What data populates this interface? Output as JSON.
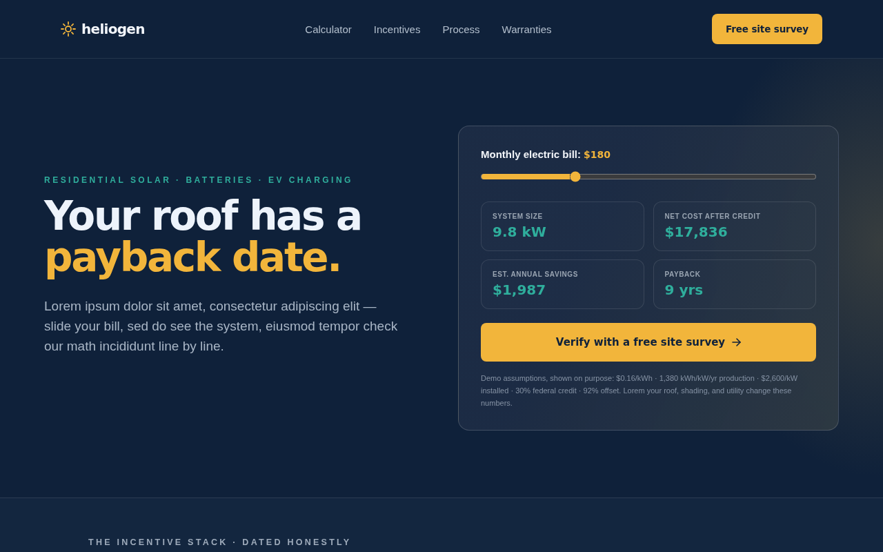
{
  "nav": {
    "brand": "heliogen",
    "links": [
      "Calculator",
      "Incentives",
      "Process",
      "Warranties"
    ],
    "cta": "Free site survey"
  },
  "hero": {
    "eyebrow": "RESIDENTIAL SOLAR · BATTERIES · EV CHARGING",
    "headline": "Your roof has a",
    "headline_accent": "payback date.",
    "lead": "Lorem ipsum dolor sit amet, consectetur adipiscing elit — slide your bill, sed do see the system, eiusmod tempor check our math incididunt line by line."
  },
  "calculator": {
    "bill_slider": {
      "label": "Monthly electric bill:",
      "reading": "$180",
      "level": 0.28
    },
    "stats": [
      {
        "label": "SYSTEM SIZE",
        "value": "9.8 kW"
      },
      {
        "label": "NET COST AFTER CREDIT",
        "value": "$17,836"
      },
      {
        "label": "EST. ANNUAL SAVINGS",
        "value": "$1,987"
      },
      {
        "label": "PAYBACK",
        "value": "9 yrs"
      }
    ],
    "button": "Verify with a free site survey",
    "note": "Demo assumptions, shown on purpose: $0.16/kWh · 1,380 kWh/kW/yr production · $2,600/kW installed · 30% federal credit · 92% offset. Lorem your roof, shading, and utility change these numbers."
  },
  "next_section": {
    "eyebrow": "THE INCENTIVE STACK · DATED HONESTLY"
  }
}
